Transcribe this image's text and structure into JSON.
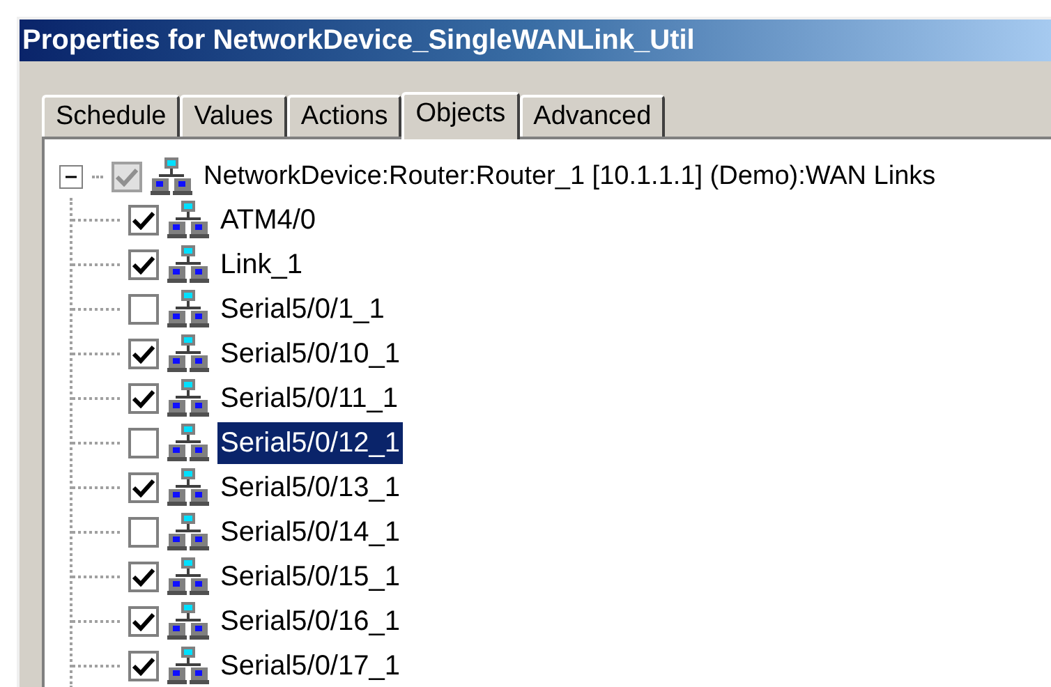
{
  "window": {
    "title": "Properties for NetworkDevice_SingleWANLink_Util"
  },
  "tabs": [
    {
      "label": "Schedule",
      "selected": false
    },
    {
      "label": "Values",
      "selected": false
    },
    {
      "label": "Actions",
      "selected": false
    },
    {
      "label": "Objects",
      "selected": true
    },
    {
      "label": "Advanced",
      "selected": false
    }
  ],
  "tree": {
    "label": "NetworkDevice:Router:Router_1 [10.1.1.1] (Demo):WAN Links",
    "expanded": true,
    "checked": true,
    "disabled": true,
    "selected": false,
    "children": [
      {
        "label": "ATM4/0",
        "checked": true,
        "selected": false
      },
      {
        "label": "Link_1",
        "checked": true,
        "selected": false
      },
      {
        "label": "Serial5/0/1_1",
        "checked": false,
        "selected": false
      },
      {
        "label": "Serial5/0/10_1",
        "checked": true,
        "selected": false
      },
      {
        "label": "Serial5/0/11_1",
        "checked": true,
        "selected": false
      },
      {
        "label": "Serial5/0/12_1",
        "checked": false,
        "selected": true
      },
      {
        "label": "Serial5/0/13_1",
        "checked": true,
        "selected": false
      },
      {
        "label": "Serial5/0/14_1",
        "checked": false,
        "selected": false
      },
      {
        "label": "Serial5/0/15_1",
        "checked": true,
        "selected": false
      },
      {
        "label": "Serial5/0/16_1",
        "checked": true,
        "selected": false
      },
      {
        "label": "Serial5/0/17_1",
        "checked": true,
        "selected": false
      }
    ]
  }
}
